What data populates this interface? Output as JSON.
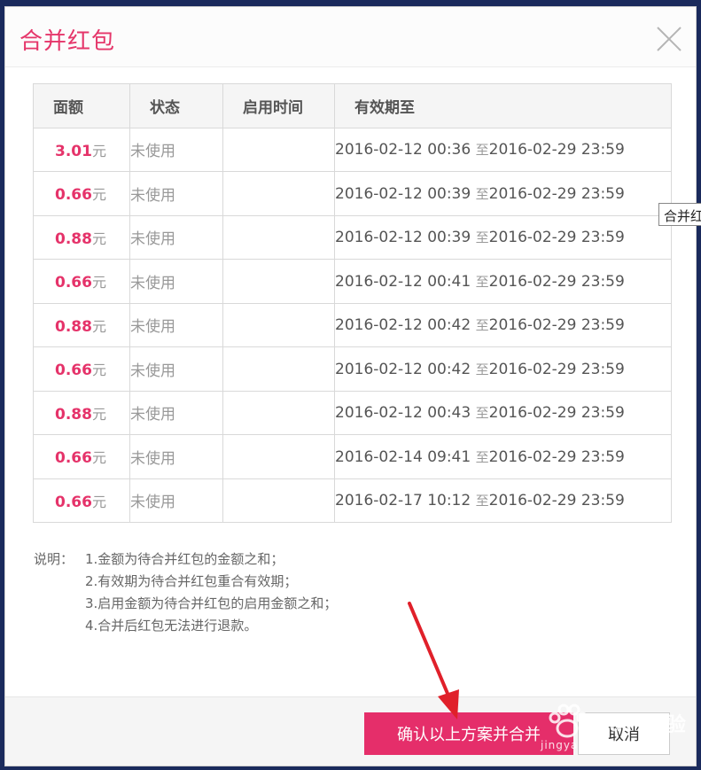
{
  "dialog": {
    "title": "合并红包",
    "close_icon": "close-icon"
  },
  "table": {
    "headers": [
      "面额",
      "状态",
      "启用时间",
      "有效期至"
    ],
    "rows": [
      {
        "amount": "3.01",
        "unit": "元",
        "status": "未使用",
        "start": "",
        "from": "2016-02-12 00:36",
        "sep": "至",
        "to": "2016-02-29 23:59"
      },
      {
        "amount": "0.66",
        "unit": "元",
        "status": "未使用",
        "start": "",
        "from": "2016-02-12 00:39",
        "sep": "至",
        "to": "2016-02-29 23:59"
      },
      {
        "amount": "0.88",
        "unit": "元",
        "status": "未使用",
        "start": "",
        "from": "2016-02-12 00:39",
        "sep": "至",
        "to": "2016-02-29 23:59"
      },
      {
        "amount": "0.66",
        "unit": "元",
        "status": "未使用",
        "start": "",
        "from": "2016-02-12 00:41",
        "sep": "至",
        "to": "2016-02-29 23:59"
      },
      {
        "amount": "0.88",
        "unit": "元",
        "status": "未使用",
        "start": "",
        "from": "2016-02-12 00:42",
        "sep": "至",
        "to": "2016-02-29 23:59"
      },
      {
        "amount": "0.66",
        "unit": "元",
        "status": "未使用",
        "start": "",
        "from": "2016-02-12 00:42",
        "sep": "至",
        "to": "2016-02-29 23:59"
      },
      {
        "amount": "0.88",
        "unit": "元",
        "status": "未使用",
        "start": "",
        "from": "2016-02-12 00:43",
        "sep": "至",
        "to": "2016-02-29 23:59"
      },
      {
        "amount": "0.66",
        "unit": "元",
        "status": "未使用",
        "start": "",
        "from": "2016-02-14 09:41",
        "sep": "至",
        "to": "2016-02-29 23:59"
      },
      {
        "amount": "0.66",
        "unit": "元",
        "status": "未使用",
        "start": "",
        "from": "2016-02-17 10:12",
        "sep": "至",
        "to": "2016-02-29 23:59"
      }
    ]
  },
  "tooltip": "合并红包",
  "notes": {
    "label": "说明：",
    "items": [
      "1.金额为待合并红包的金额之和；",
      "2.有效期为待合并红包重合有效期；",
      "3.启用金额为待合并红包的启用金额之和；",
      "4.合并后红包无法进行退款。"
    ]
  },
  "footer": {
    "confirm_label": "确认以上方案并合并",
    "cancel_label": "取消"
  },
  "watermark": {
    "text": "Bai 经验",
    "sub": "jingyan.baidu.com"
  },
  "colors": {
    "accent": "#e52e6a",
    "amount": "#e5336a",
    "arrow": "#e0202a"
  }
}
